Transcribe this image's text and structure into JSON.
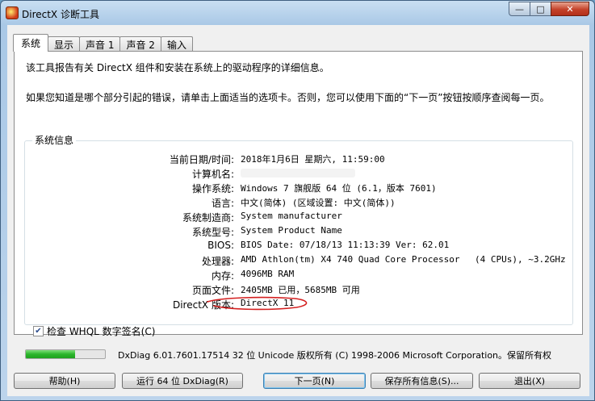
{
  "window": {
    "title": "DirectX 诊断工具",
    "min_label": "—",
    "max_label": "□",
    "close_label": "✕"
  },
  "tabs": [
    {
      "label": "系统",
      "active": true
    },
    {
      "label": "显示"
    },
    {
      "label": "声音 1"
    },
    {
      "label": "声音 2"
    },
    {
      "label": "输入"
    }
  ],
  "intro": {
    "line1": "该工具报告有关 DirectX 组件和安装在系统上的驱动程序的详细信息。",
    "line2": "如果您知道是哪个部分引起的错误，请单击上面适当的选项卡。否则，您可以使用下面的“下一页”按钮按顺序查阅每一页。"
  },
  "system_info": {
    "group_title": "系统信息",
    "rows": [
      {
        "label": "当前日期/时间:",
        "value": "2018年1月6日 星期六, 11:59:00"
      },
      {
        "label": "计算机名:",
        "value": ""
      },
      {
        "label": "操作系统:",
        "value": "Windows 7 旗舰版 64 位 (6.1，版本 7601)"
      },
      {
        "label": "语言:",
        "value": "中文(简体) (区域设置: 中文(简体))"
      },
      {
        "label": "系统制造商:",
        "value": "System manufacturer"
      },
      {
        "label": "系统型号:",
        "value": "System Product Name"
      },
      {
        "label": "BIOS:",
        "value": "BIOS Date: 07/18/13 11:13:39 Ver: 62.01"
      },
      {
        "label": "处理器:",
        "value": "AMD Athlon(tm) X4 740 Quad Core Processor",
        "extra": "(4 CPUs), ~3.2GHz"
      },
      {
        "label": "内存:",
        "value": "4096MB RAM"
      },
      {
        "label": "页面文件:",
        "value": "2405MB 已用，5685MB 可用"
      },
      {
        "label": "DirectX 版本:",
        "value": "DirectX 11"
      }
    ]
  },
  "whql": {
    "label": "检查 WHQL 数字签名(C)",
    "checked": true
  },
  "progress": {
    "percent": 62,
    "color": "#2bb52b"
  },
  "copyright": "DxDiag 6.01.7601.17514 32 位 Unicode 版权所有 (C) 1998-2006 Microsoft Corporation。保留所有权",
  "buttons": {
    "help": "帮助(H)",
    "run64": "运行 64 位 DxDiag(R)",
    "next": "下一页(N)",
    "save": "保存所有信息(S)...",
    "exit": "退出(X)"
  },
  "accent_colors": {
    "annotation_red": "#d42020",
    "titlebar": "#bcd4ec"
  }
}
